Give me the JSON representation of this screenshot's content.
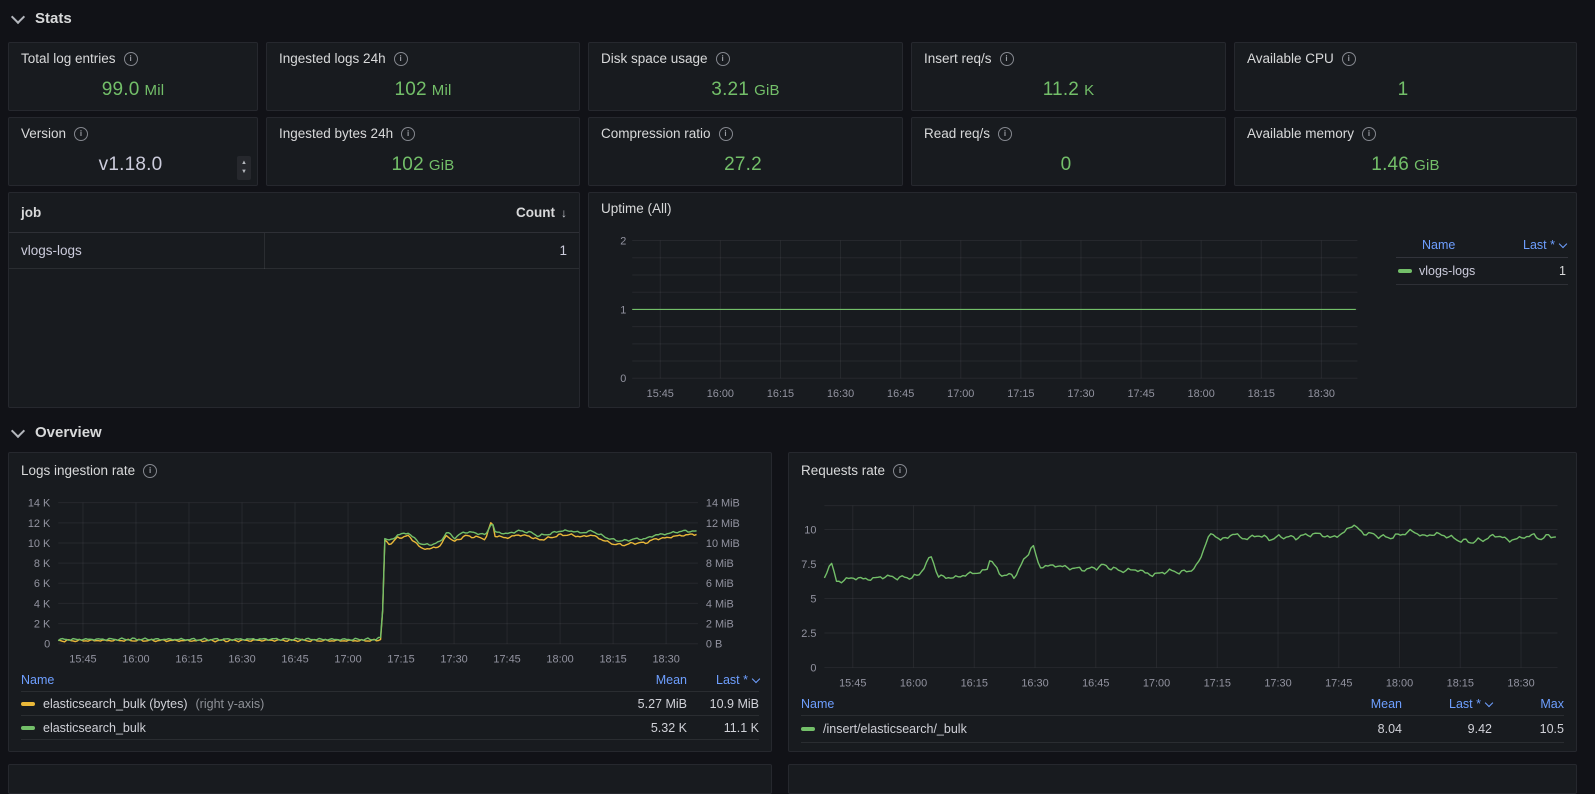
{
  "sections": {
    "stats": "Stats",
    "overview": "Overview"
  },
  "icons": {
    "info": "i",
    "sort_desc": "↓",
    "stepper_up": "▲",
    "stepper_down": "▼"
  },
  "colors": {
    "green": "#73bf69",
    "yellow": "#eab839",
    "link_blue": "#6e9fff",
    "panel_bg": "#181b1f",
    "page_bg": "#111217"
  },
  "stat_panels": [
    {
      "title": "Total log entries",
      "num": "99.0",
      "unit": "Mil",
      "value_color": "#73bf69"
    },
    {
      "title": "Ingested logs 24h",
      "num": "102",
      "unit": "Mil",
      "value_color": "#73bf69"
    },
    {
      "title": "Disk space usage",
      "num": "3.21",
      "unit": "GiB",
      "value_color": "#73bf69"
    },
    {
      "title": "Insert req/s",
      "num": "11.2",
      "unit": "K",
      "value_color": "#73bf69"
    },
    {
      "title": "Available CPU",
      "num": "1",
      "unit": "",
      "value_color": "#73bf69"
    },
    {
      "title": "Version",
      "num": "v1.18.0",
      "unit": "",
      "value_color": "#ccccdc"
    },
    {
      "title": "Ingested bytes 24h",
      "num": "102",
      "unit": "GiB",
      "value_color": "#73bf69"
    },
    {
      "title": "Compression ratio",
      "num": "27.2",
      "unit": "",
      "value_color": "#73bf69"
    },
    {
      "title": "Read req/s",
      "num": "0",
      "unit": "",
      "value_color": "#73bf69"
    },
    {
      "title": "Available memory",
      "num": "1.46",
      "unit": "GiB",
      "value_color": "#73bf69"
    }
  ],
  "job_table": {
    "col_job": "job",
    "col_count": "Count",
    "rows": [
      {
        "job": "vlogs-logs",
        "count": "1"
      }
    ]
  },
  "chart_data": [
    {
      "id": "uptime",
      "type": "line",
      "title": "Uptime (All)",
      "x_range": [
        0,
        181
      ],
      "x_ticks": [
        {
          "t": 7,
          "label": "15:45"
        },
        {
          "t": 22,
          "label": "16:00"
        },
        {
          "t": 37,
          "label": "16:15"
        },
        {
          "t": 52,
          "label": "16:30"
        },
        {
          "t": 67,
          "label": "16:45"
        },
        {
          "t": 82,
          "label": "17:00"
        },
        {
          "t": 97,
          "label": "17:15"
        },
        {
          "t": 112,
          "label": "17:30"
        },
        {
          "t": 127,
          "label": "17:45"
        },
        {
          "t": 142,
          "label": "18:00"
        },
        {
          "t": 157,
          "label": "18:15"
        },
        {
          "t": 172,
          "label": "18:30"
        }
      ],
      "ylim": [
        0,
        2
      ],
      "y_grid_step": 0.25,
      "y_ticks_left": [
        {
          "v": 2,
          "label": "2"
        },
        {
          "v": 1,
          "label": "1"
        },
        {
          "v": 0,
          "label": "0"
        }
      ],
      "series": [
        {
          "name": "vlogs-logs",
          "color": "#73bf69",
          "axis": "left",
          "jitter": 0,
          "seed": 1,
          "width": 1.2,
          "points": [
            [
              0,
              1
            ],
            [
              181,
              1
            ]
          ]
        }
      ],
      "legend": {
        "position": "right",
        "headers": [
          "Name",
          "Last *"
        ],
        "rows": [
          {
            "color": "#73bf69",
            "name": "vlogs-logs",
            "values": [
              "1"
            ]
          }
        ]
      }
    },
    {
      "id": "logs",
      "type": "line",
      "title": "Logs ingestion rate",
      "x_range": [
        0,
        181
      ],
      "x_ticks": [
        {
          "t": 7,
          "label": "15:45"
        },
        {
          "t": 22,
          "label": "16:00"
        },
        {
          "t": 37,
          "label": "16:15"
        },
        {
          "t": 52,
          "label": "16:30"
        },
        {
          "t": 67,
          "label": "16:45"
        },
        {
          "t": 82,
          "label": "17:00"
        },
        {
          "t": 97,
          "label": "17:15"
        },
        {
          "t": 112,
          "label": "17:30"
        },
        {
          "t": 127,
          "label": "17:45"
        },
        {
          "t": 142,
          "label": "18:00"
        },
        {
          "t": 157,
          "label": "18:15"
        },
        {
          "t": 172,
          "label": "18:30"
        }
      ],
      "ylim": [
        0,
        14
      ],
      "y_ticks_left": [
        {
          "v": 14,
          "label": "14 K"
        },
        {
          "v": 12,
          "label": "12 K"
        },
        {
          "v": 10,
          "label": "10 K"
        },
        {
          "v": 8,
          "label": "8 K"
        },
        {
          "v": 6,
          "label": "6 K"
        },
        {
          "v": 4,
          "label": "4 K"
        },
        {
          "v": 2,
          "label": "2 K"
        },
        {
          "v": 0,
          "label": "0"
        }
      ],
      "y_ticks_right": [
        {
          "v": 14,
          "label": "14 MiB"
        },
        {
          "v": 12,
          "label": "12 MiB"
        },
        {
          "v": 10,
          "label": "10 MiB"
        },
        {
          "v": 8,
          "label": "8 MiB"
        },
        {
          "v": 6,
          "label": "6 MiB"
        },
        {
          "v": 4,
          "label": "4 MiB"
        },
        {
          "v": 2,
          "label": "2 MiB"
        },
        {
          "v": 0,
          "label": "0 B"
        }
      ],
      "series": [
        {
          "name": "elasticsearch_bulk (bytes)",
          "color": "#eab839",
          "axis": "right",
          "jitter": 0.14,
          "seed": 2,
          "points": [
            [
              0,
              0.3
            ],
            [
              20,
              0.33
            ],
            [
              40,
              0.3
            ],
            [
              60,
              0.34
            ],
            [
              80,
              0.3
            ],
            [
              90,
              0.32
            ],
            [
              91.6,
              0.5
            ],
            [
              92.3,
              10.2
            ],
            [
              94,
              9.9
            ],
            [
              96,
              10.5
            ],
            [
              99,
              10.7
            ],
            [
              101,
              10.1
            ],
            [
              102.5,
              9.5
            ],
            [
              105,
              9.4
            ],
            [
              108,
              9.7
            ],
            [
              110,
              10.8
            ],
            [
              112,
              10.1
            ],
            [
              115,
              10.7
            ],
            [
              118,
              10.6
            ],
            [
              121,
              10.4
            ],
            [
              122.7,
              12.35
            ],
            [
              123.6,
              10.7
            ],
            [
              127,
              10.5
            ],
            [
              130,
              10.8
            ],
            [
              133,
              10.7
            ],
            [
              136,
              10.3
            ],
            [
              139,
              10.5
            ],
            [
              142,
              10.8
            ],
            [
              145,
              10.8
            ],
            [
              148,
              10.6
            ],
            [
              151,
              10.8
            ],
            [
              154,
              10.3
            ],
            [
              157,
              9.9
            ],
            [
              160,
              9.8
            ],
            [
              163,
              10.0
            ],
            [
              166,
              10.0
            ],
            [
              169,
              10.4
            ],
            [
              172,
              10.5
            ],
            [
              175,
              10.7
            ],
            [
              178,
              10.8
            ],
            [
              181,
              10.9
            ]
          ]
        },
        {
          "name": "elasticsearch_bulk",
          "color": "#73bf69",
          "axis": "left",
          "jitter": 0.14,
          "seed": 5,
          "points": [
            [
              0,
              0.42
            ],
            [
              20,
              0.45
            ],
            [
              40,
              0.42
            ],
            [
              60,
              0.46
            ],
            [
              80,
              0.42
            ],
            [
              90,
              0.44
            ],
            [
              91.6,
              0.6
            ],
            [
              92.3,
              10.5
            ],
            [
              94,
              10.2
            ],
            [
              96,
              10.8
            ],
            [
              99,
              11.0
            ],
            [
              101,
              10.4
            ],
            [
              102.5,
              9.9
            ],
            [
              105,
              9.8
            ],
            [
              108,
              10.1
            ],
            [
              110,
              11.1
            ],
            [
              112,
              10.5
            ],
            [
              115,
              11.1
            ],
            [
              118,
              11.0
            ],
            [
              121,
              10.8
            ],
            [
              122.7,
              12.1
            ],
            [
              123.6,
              11.1
            ],
            [
              127,
              10.9
            ],
            [
              130,
              11.2
            ],
            [
              133,
              11.1
            ],
            [
              136,
              10.7
            ],
            [
              139,
              10.9
            ],
            [
              142,
              11.2
            ],
            [
              145,
              11.2
            ],
            [
              148,
              11.0
            ],
            [
              151,
              11.2
            ],
            [
              154,
              10.7
            ],
            [
              157,
              10.3
            ],
            [
              160,
              10.2
            ],
            [
              163,
              10.4
            ],
            [
              166,
              10.4
            ],
            [
              169,
              10.8
            ],
            [
              172,
              10.9
            ],
            [
              175,
              11.1
            ],
            [
              178,
              11.2
            ],
            [
              181,
              11.1
            ]
          ]
        }
      ],
      "legend": {
        "position": "bottom",
        "headers": [
          "Name",
          "Mean",
          "Last *"
        ],
        "rows": [
          {
            "color": "#eab839",
            "name": "elasticsearch_bulk (bytes)",
            "suffix": "(right y-axis)",
            "values": [
              "5.27 MiB",
              "10.9 MiB"
            ]
          },
          {
            "color": "#73bf69",
            "name": "elasticsearch_bulk",
            "suffix": "",
            "values": [
              "5.32 K",
              "11.1 K"
            ]
          }
        ]
      }
    },
    {
      "id": "requests",
      "type": "line",
      "title": "Requests rate",
      "x_range": [
        0,
        181
      ],
      "x_ticks": [
        {
          "t": 7,
          "label": "15:45"
        },
        {
          "t": 22,
          "label": "16:00"
        },
        {
          "t": 37,
          "label": "16:15"
        },
        {
          "t": 52,
          "label": "16:30"
        },
        {
          "t": 67,
          "label": "16:45"
        },
        {
          "t": 82,
          "label": "17:00"
        },
        {
          "t": 97,
          "label": "17:15"
        },
        {
          "t": 112,
          "label": "17:30"
        },
        {
          "t": 127,
          "label": "17:45"
        },
        {
          "t": 142,
          "label": "18:00"
        },
        {
          "t": 157,
          "label": "18:15"
        },
        {
          "t": 172,
          "label": "18:30"
        }
      ],
      "ylim": [
        0,
        11.73
      ],
      "y_ticks_left": [
        {
          "v": 10,
          "label": "10"
        },
        {
          "v": 7.5,
          "label": "7.5"
        },
        {
          "v": 5,
          "label": "5"
        },
        {
          "v": 2.5,
          "label": "2.5"
        },
        {
          "v": 0,
          "label": "0"
        }
      ],
      "series": [
        {
          "name": "/insert/elasticsearch/_bulk",
          "color": "#73bf69",
          "axis": "left",
          "jitter": 0.2,
          "seed": 9,
          "points": [
            [
              0,
              6.4
            ],
            [
              1.5,
              7.8
            ],
            [
              3,
              6.2
            ],
            [
              7,
              6.5
            ],
            [
              11,
              6.4
            ],
            [
              15,
              6.6
            ],
            [
              19,
              6.5
            ],
            [
              23,
              6.6
            ],
            [
              26.5,
              8.1
            ],
            [
              28,
              6.6
            ],
            [
              32,
              6.5
            ],
            [
              36,
              6.8
            ],
            [
              40,
              7.0
            ],
            [
              41,
              8.0
            ],
            [
              43,
              6.8
            ],
            [
              47,
              6.6
            ],
            [
              51.5,
              8.9
            ],
            [
              53,
              7.3
            ],
            [
              57,
              7.4
            ],
            [
              61,
              7.2
            ],
            [
              65,
              7.1
            ],
            [
              69,
              7.4
            ],
            [
              73,
              7.0
            ],
            [
              77,
              7.1
            ],
            [
              81,
              6.7
            ],
            [
              85,
              7.0
            ],
            [
              89,
              6.9
            ],
            [
              92,
              7.3
            ],
            [
              94.5,
              9.3
            ],
            [
              96,
              9.7
            ],
            [
              98,
              9.2
            ],
            [
              101,
              9.7
            ],
            [
              104,
              9.3
            ],
            [
              107,
              9.6
            ],
            [
              110,
              9.3
            ],
            [
              113,
              9.5
            ],
            [
              116,
              9.4
            ],
            [
              119,
              9.6
            ],
            [
              122,
              9.7
            ],
            [
              125,
              9.4
            ],
            [
              128,
              9.7
            ],
            [
              130.5,
              10.4
            ],
            [
              132.5,
              9.8
            ],
            [
              136,
              9.6
            ],
            [
              139,
              9.4
            ],
            [
              142,
              9.6
            ],
            [
              145,
              9.9
            ],
            [
              148,
              9.5
            ],
            [
              151,
              9.7
            ],
            [
              154,
              9.5
            ],
            [
              157,
              9.2
            ],
            [
              160,
              9.1
            ],
            [
              163,
              9.3
            ],
            [
              166,
              9.6
            ],
            [
              169,
              9.2
            ],
            [
              172,
              9.4
            ],
            [
              175,
              9.6
            ],
            [
              177,
              9.3
            ],
            [
              179,
              9.6
            ],
            [
              181,
              9.42
            ]
          ]
        }
      ],
      "legend": {
        "position": "bottom",
        "headers": [
          "Name",
          "Mean",
          "Last *",
          "Max"
        ],
        "rows": [
          {
            "color": "#73bf69",
            "name": "/insert/elasticsearch/_bulk",
            "suffix": "",
            "values": [
              "8.04",
              "9.42",
              "10.5"
            ]
          }
        ]
      }
    }
  ]
}
